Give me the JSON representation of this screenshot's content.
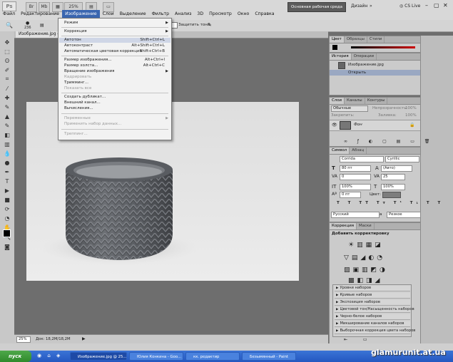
{
  "app": {
    "logo": "Ps",
    "workspace": "Основная рабочая среда",
    "design": "Дизайн",
    "cslive": "CS Live"
  },
  "menubar": [
    "Файл",
    "Редактирование",
    "Изображение",
    "Слои",
    "Выделение",
    "Фильтр",
    "Анализ",
    "3D",
    "Просмотр",
    "Окно",
    "Справка"
  ],
  "zoom_top": "25%",
  "options": {
    "brush_size": "236",
    "protect_tones": "Защитить тона"
  },
  "doc": {
    "tab": "Изображение.jpg @ 25% (RGB/8) *",
    "status_zoom": "25%",
    "status_doc": "Док: 18,2M/18,2M"
  },
  "image_menu": [
    {
      "label": "Режим",
      "arrow": true
    },
    {
      "label": "Коррекция",
      "arrow": true
    },
    {
      "label": "Автотон",
      "shortcut": "Shift+Ctrl+L",
      "highlight": true
    },
    {
      "label": "Автоконтраст",
      "shortcut": "Alt+Shift+Ctrl+L"
    },
    {
      "label": "Автоматическая цветовая коррекция",
      "shortcut": "Shift+Ctrl+B"
    },
    {
      "label": "Размер изображения...",
      "shortcut": "Alt+Ctrl+I"
    },
    {
      "label": "Размер холста...",
      "shortcut": "Alt+Ctrl+C"
    },
    {
      "label": "Вращение изображения",
      "arrow": true
    },
    {
      "label": "Кадрировать",
      "disabled": true
    },
    {
      "label": "Тримминг..."
    },
    {
      "label": "Показать все",
      "disabled": true
    },
    {
      "label": "Создать дубликат..."
    },
    {
      "label": "Внешний канал..."
    },
    {
      "label": "Вычисления..."
    },
    {
      "label": "Переменные",
      "arrow": true,
      "disabled": true
    },
    {
      "label": "Применить набор данных...",
      "disabled": true
    },
    {
      "label": "Треппинг...",
      "disabled": true
    }
  ],
  "color_panel": {
    "tabs": [
      "Цвет",
      "Образцы",
      "Стили"
    ]
  },
  "history_panel": {
    "tabs": [
      "История",
      "Операции"
    ],
    "items": [
      "Изображение.jpg",
      "Открыть"
    ]
  },
  "layers_panel": {
    "tabs": [
      "Слои",
      "Каналы",
      "Контуры"
    ],
    "blend": "Обычные",
    "opacity_label": "Непрозрачность:",
    "opacity": "100%",
    "lock_label": "Закрепить:",
    "fill_label": "Заливка:",
    "fill": "100%",
    "layer_name": "Фон"
  },
  "char_panel": {
    "tabs": [
      "Символ",
      "Абзац"
    ],
    "font": "Corrida",
    "style": "Cyrillic",
    "size": "80 пт",
    "leading": "(Авто)",
    "kerning": "0",
    "tracking": "25",
    "vscale": "100%",
    "hscale": "100%",
    "baseline": "0 пт",
    "color_label": "Цвет:",
    "language": "Русский",
    "aa": "Резкое",
    "aa_prefix": "а"
  },
  "adj_panel": {
    "tabs": [
      "Коррекция",
      "Маски"
    ],
    "title": "Добавить корректировку",
    "presets": [
      "Уровни наборов",
      "Кривые наборов",
      "Экспозиция наборов",
      "Цветовой тон/Насыщенность наборов",
      "Черно-белое наборов",
      "Микширование каналов наборов",
      "Выборочная коррекция цвета наборов"
    ]
  },
  "taskbar": {
    "start": "пуск",
    "tasks": [
      "Изображение.jpg @ 25...",
      "Юлия Конкина - Goo...",
      "кк. редактир",
      "Безымянный - Paint"
    ],
    "watermark": "glamurunit.at.ua"
  }
}
